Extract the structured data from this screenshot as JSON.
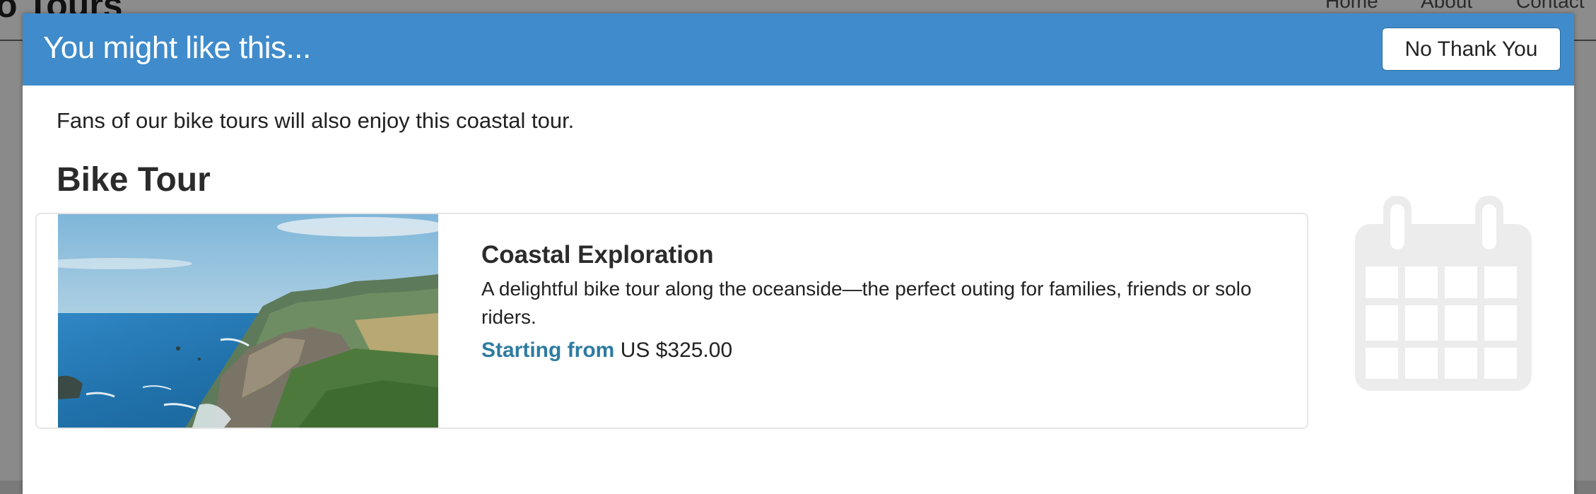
{
  "background_page": {
    "site_title": "o Tours",
    "nav": [
      "Home",
      "About",
      "Contact"
    ]
  },
  "modal": {
    "title": "You might like this...",
    "decline_label": "No Thank You",
    "intro": "Fans of our bike tours will also enjoy this coastal tour.",
    "section_heading": "Bike Tour",
    "tour": {
      "name": "Coastal Exploration",
      "description": "A delightful bike tour along the oceanside—the perfect outing for families, friends or solo riders.",
      "price_label": "Starting from",
      "price_value": "US $325.00",
      "image": "coastal-cliffs-photo"
    },
    "decor_icon": "calendar-icon"
  },
  "colors": {
    "header_blue": "#3f8bcb",
    "price_label": "#2e7ba0",
    "icon_gray": "#ececec"
  }
}
